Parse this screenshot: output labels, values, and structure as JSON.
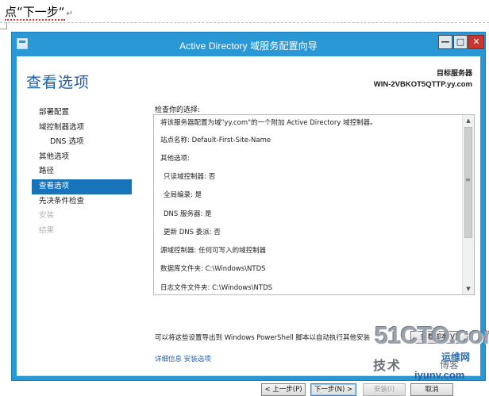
{
  "doc": {
    "instruction": "点“下一步“",
    "paragraph_mark": "↵"
  },
  "window": {
    "title": "Active Directory 域服务配置向导",
    "controls": {
      "minimize": "—",
      "maximize": "□",
      "close": "✕"
    }
  },
  "page": {
    "title": "查看选项",
    "target_label": "目标服务器",
    "target_value": "WIN-2VBKOT5QTTP.yy.com"
  },
  "nav": [
    {
      "label": "部署配置",
      "state": "normal"
    },
    {
      "label": "域控制器选项",
      "state": "normal"
    },
    {
      "label": "DNS 选项",
      "state": "sub"
    },
    {
      "label": "其他选项",
      "state": "normal"
    },
    {
      "label": "路径",
      "state": "normal"
    },
    {
      "label": "查看选项",
      "state": "active"
    },
    {
      "label": "先决条件检查",
      "state": "normal"
    },
    {
      "label": "安装",
      "state": "disabled"
    },
    {
      "label": "结果",
      "state": "disabled"
    }
  ],
  "review": {
    "label": "检查你的选择:",
    "lines": [
      "将该服务器配置为域\"yy.com\"的一个附加 Active Directory 域控制器。",
      "站点名称: Default-First-Site-Name",
      "其他选项:",
      "只读域控制器: 否",
      "全局编录: 是",
      "DNS 服务器: 是",
      "更新 DNS 委派: 否",
      "源域控制器: 任何可写入的域控制器",
      "数据库文件夹: C:\\Windows\\NTDS",
      "日志文件文件夹: C:\\Windows\\NTDS"
    ],
    "scroll_arrows": {
      "up": "▲",
      "down": "▼",
      "grip": "≡"
    }
  },
  "export": {
    "text": "可以将这些设置导出到 Windows PowerShell 脚本以自动执行其他安装",
    "view_script_button": "查看脚本(V)"
  },
  "more_link": "详细信息 安装选项",
  "buttons": {
    "prev": "< 上一步(P)",
    "next": "下一步(N) >",
    "install": "安装(I)",
    "cancel": "取消"
  },
  "watermark": {
    "main": "51CTO.com",
    "tech": "技术",
    "blog": "博客",
    "site": "运维网",
    "url": "iyunv.com"
  },
  "colors": {
    "window_frame": "#2a98d4",
    "title_blue": "#1d5fa3",
    "active_nav": "#1973b8",
    "close_red": "#c7372f"
  }
}
